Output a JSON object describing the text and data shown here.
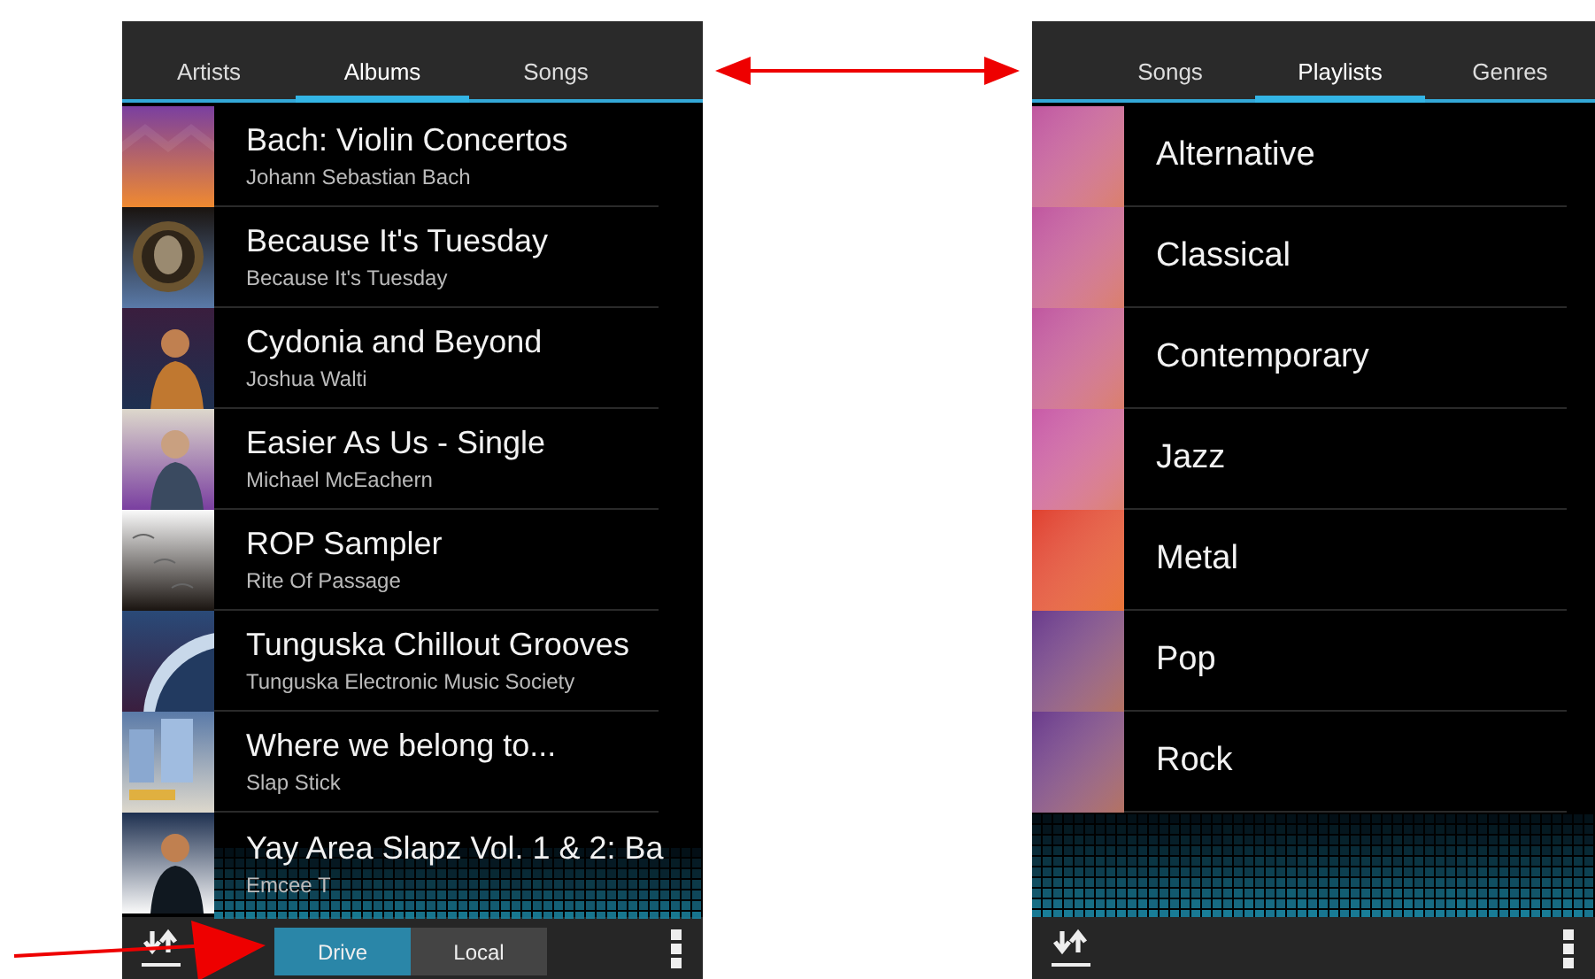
{
  "albums_screen": {
    "tabs": [
      {
        "label": "Artists",
        "selected": false
      },
      {
        "label": "Albums",
        "selected": true
      },
      {
        "label": "Songs",
        "selected": false
      }
    ],
    "albums": [
      {
        "title": "Bach: Violin Concertos",
        "artist": "Johann Sebastian Bach"
      },
      {
        "title": "Because It's Tuesday",
        "artist": "Because It's Tuesday"
      },
      {
        "title": "Cydonia and Beyond",
        "artist": "Joshua Walti"
      },
      {
        "title": "Easier As Us - Single",
        "artist": "Michael McEachern"
      },
      {
        "title": "ROP Sampler",
        "artist": "Rite Of Passage"
      },
      {
        "title": "Tunguska Chillout Grooves",
        "artist": "Tunguska Electronic Music Society"
      },
      {
        "title": "Where we belong to...",
        "artist": "Slap Stick"
      },
      {
        "title": "Yay Area Slapz Vol. 1 & 2: Ba",
        "artist": "Emcee T"
      }
    ],
    "sources": [
      {
        "label": "Drive",
        "selected": true
      },
      {
        "label": "Local",
        "selected": false
      }
    ]
  },
  "playlists_screen": {
    "tabs": [
      {
        "label": "Songs",
        "selected": false
      },
      {
        "label": "Playlists",
        "selected": true
      },
      {
        "label": "Genres",
        "selected": false
      }
    ],
    "playlists": [
      {
        "name": "Alternative",
        "color": "#c0569e"
      },
      {
        "name": "Classical",
        "color": "#c0569e"
      },
      {
        "name": "Contemporary",
        "color": "#c0569e"
      },
      {
        "name": "Jazz",
        "color": "#c85aa6"
      },
      {
        "name": "Metal",
        "color": "#e0402e"
      },
      {
        "name": "Pop",
        "color": "#6a3a8a"
      },
      {
        "name": "Rock",
        "color": "#6a3a8a"
      }
    ]
  }
}
